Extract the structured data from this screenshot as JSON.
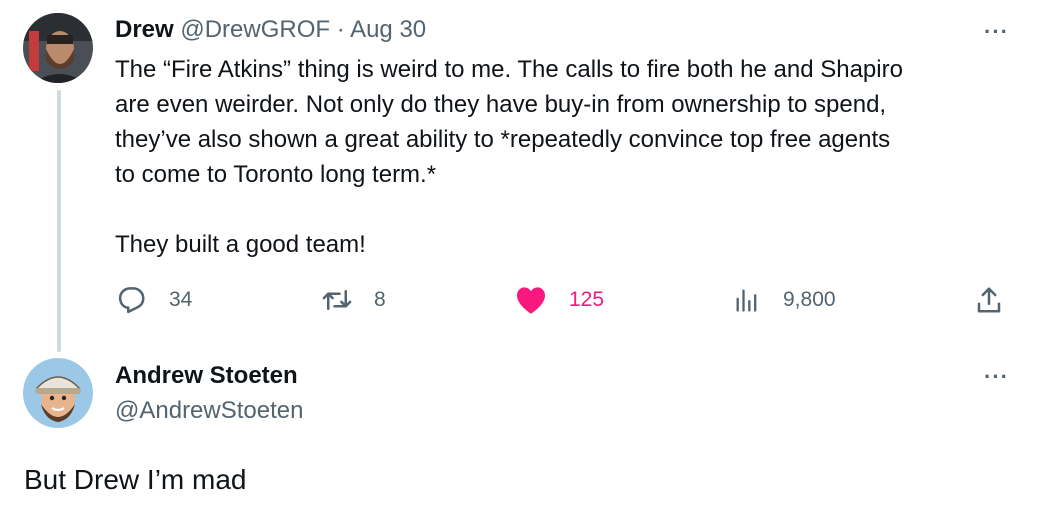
{
  "tweet": {
    "author_name": "Drew",
    "author_handle": "@DrewGROF",
    "separator": "·",
    "date": "Aug 30",
    "text": "The “Fire Atkins” thing is weird to me. The calls to fire both he and Shapiro\nare even weirder. Not only do they have buy-in from ownership to spend,\nthey’ve also shown a great ability to *repeatedly convince top free agents\nto come to Toronto long term.*\n\nThey built a good team!",
    "more_label": "···",
    "replies": "34",
    "reposts": "8",
    "likes": "125",
    "views": "9,800",
    "like_color": "#f91880"
  },
  "reply": {
    "author_name": "Andrew Stoeten",
    "author_handle": "@AndrewStoeten",
    "more_label": "···",
    "text": "But Drew I’m mad"
  },
  "icons": {
    "reply": "reply-icon",
    "repost": "repost-icon",
    "like": "heart-icon",
    "views": "views-icon",
    "share": "share-icon"
  }
}
